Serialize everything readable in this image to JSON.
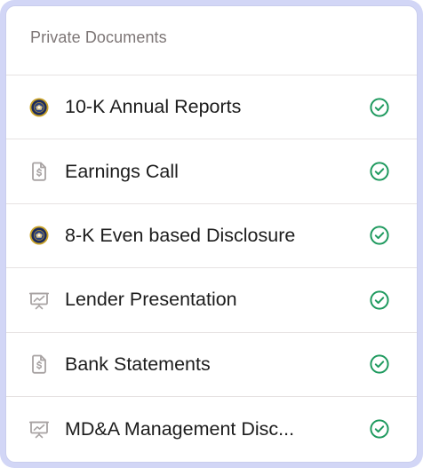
{
  "panel": {
    "title": "Private Documents"
  },
  "documents": [
    {
      "label": "10-K Annual Reports",
      "icon": "sec-seal-icon",
      "status": "verified-check-icon"
    },
    {
      "label": "Earnings Call",
      "icon": "dollar-file-icon",
      "status": "verified-check-icon"
    },
    {
      "label": "8-K Even based Disclosure",
      "icon": "sec-seal-icon",
      "status": "verified-check-icon"
    },
    {
      "label": "Lender Presentation",
      "icon": "presentation-chart-icon",
      "status": "verified-check-icon"
    },
    {
      "label": "Bank Statements",
      "icon": "dollar-file-icon",
      "status": "verified-check-icon"
    },
    {
      "label": "MD&A Management Disc...",
      "icon": "presentation-chart-icon",
      "status": "verified-check-icon"
    }
  ],
  "colors": {
    "frame": "#d2d6f6",
    "check": "#1f9a5f",
    "seal_navy": "#1b2a5c",
    "seal_gold": "#c9a227",
    "file_gray": "#a8a3a3"
  }
}
